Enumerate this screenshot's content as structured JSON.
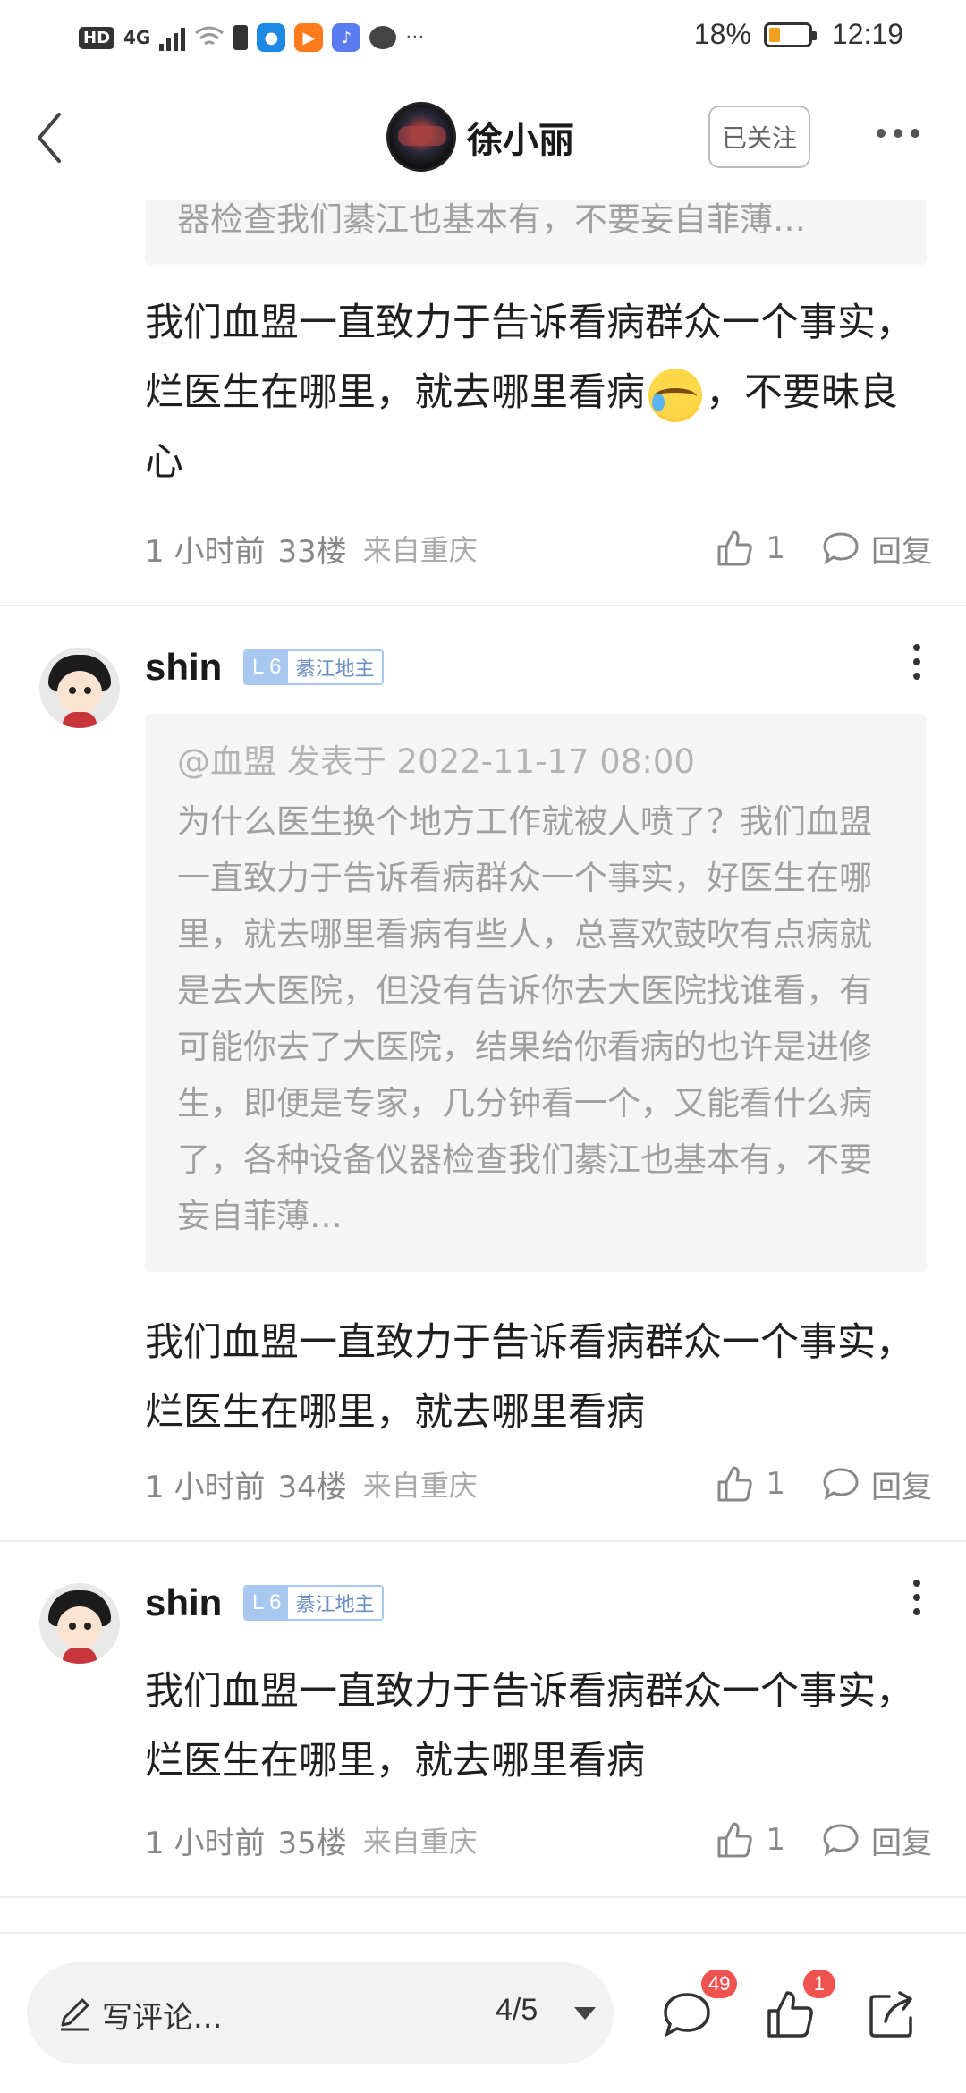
{
  "status_bar": {
    "left_labels": [
      "HD",
      "4G"
    ],
    "battery_percent": "18%",
    "battery_level": 0.18,
    "time": "12:19",
    "overflow": "···"
  },
  "nav": {
    "title": "徐小丽",
    "follow_label": "已关注"
  },
  "clipped_quote_line": "器检查我们綦江也基本有，不要妄自菲薄…",
  "posts": [
    {
      "text_before_emoji": "我们血盟一直致力于告诉看病群众一个事实，烂医生在哪里，就去哪里看病",
      "text_after_emoji": "，不要昧良心",
      "time": "1 小时前",
      "floor": "33楼",
      "location": "来自重庆",
      "likes": "1",
      "reply_label": "回复"
    },
    {
      "username": "shin",
      "level": "L 6",
      "level_title": "綦江地主",
      "quote_header": "@血盟 发表于 2022-11-17 08:00",
      "quote_body": "为什么医生换个地方工作就被人喷了？我们血盟一直致力于告诉看病群众一个事实，好医生在哪里，就去哪里看病有些人，总喜欢鼓吹有点病就是去大医院，但没有告诉你去大医院找谁看，有可能你去了大医院，结果给你看病的也许是进修生，即便是专家，几分钟看一个，又能看什么病了，各种设备仪器检查我们綦江也基本有，不要妄自菲薄…",
      "text": "我们血盟一直致力于告诉看病群众一个事实，烂医生在哪里，就去哪里看病",
      "time": "1 小时前",
      "floor": "34楼",
      "location": "来自重庆",
      "likes": "1",
      "reply_label": "回复"
    },
    {
      "username": "shin",
      "level": "L 6",
      "level_title": "綦江地主",
      "text": "我们血盟一直致力于告诉看病群众一个事实，烂医生在哪里，就去哪里看病",
      "time": "1 小时前",
      "floor": "35楼",
      "location": "来自重庆",
      "likes": "1",
      "reply_label": "回复"
    }
  ],
  "bottom_bar": {
    "comment_placeholder": "写评论...",
    "page_indicator": "4/5",
    "comment_count": "49",
    "like_count": "1"
  },
  "icons": [
    "back-icon",
    "more-icon",
    "like-icon",
    "reply-icon",
    "pen-icon",
    "dropdown-icon",
    "comment-icon",
    "thumb-up-icon",
    "share-icon",
    "kebab-icon"
  ],
  "colors": {
    "badge": "#ef5350",
    "level": "#a9c8ef",
    "battery": "#f2a11f"
  }
}
